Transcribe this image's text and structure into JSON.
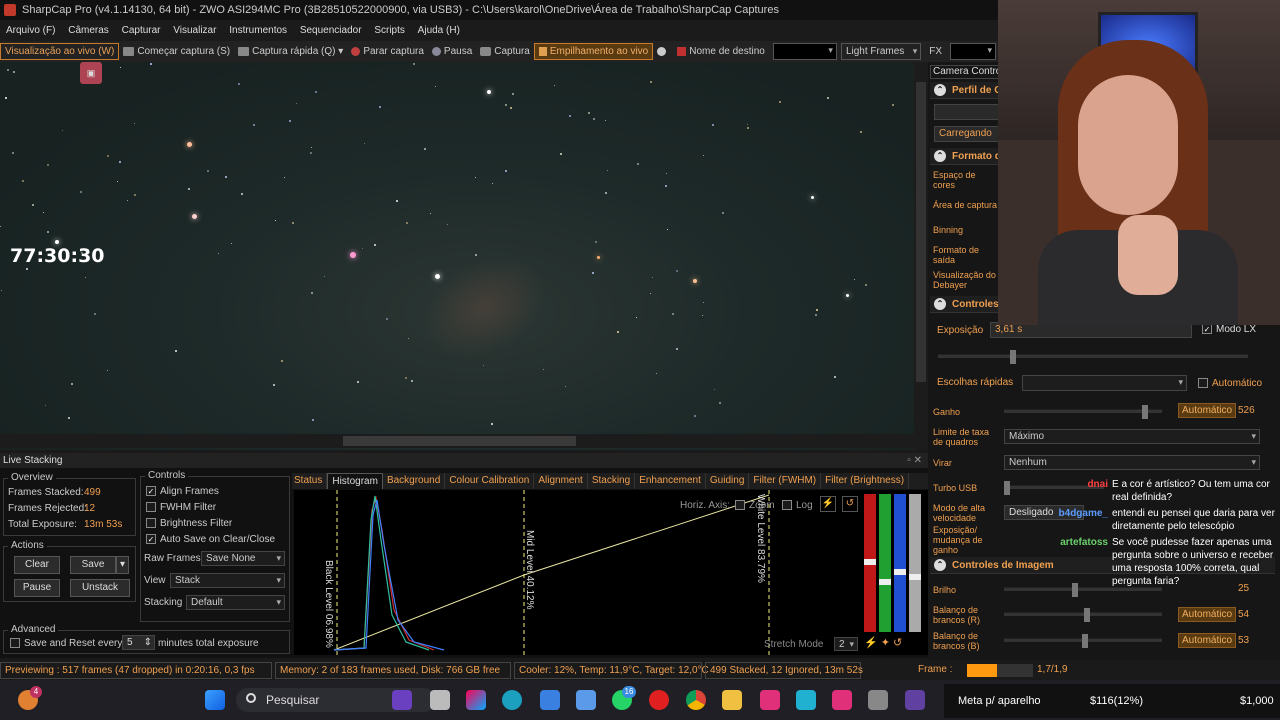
{
  "window": {
    "title": "SharpCap Pro (v4.1.14130, 64 bit) - ZWO ASI294MC Pro (3B28510522000900, via USB3) - C:\\Users\\karol\\OneDrive\\Área de Trabalho\\SharpCap Captures"
  },
  "menu": [
    "Arquivo (F)",
    "Câmeras",
    "Capturar",
    "Visualizar",
    "Instrumentos",
    "Sequenciador",
    "Scripts",
    "Ajuda (H)"
  ],
  "toolbar": {
    "live_view": "Visualização ao vivo (W)",
    "start_capture": "Começar captura (S)",
    "quick_capture": "Captura rápida (Q)",
    "stop_capture": "Parar captura",
    "pause": "Pausa",
    "capture": "Captura",
    "live_stacking": "Empilhamento ao vivo",
    "target_name": "Nome de destino",
    "frame_type": "Light Frames",
    "fx": "FX"
  },
  "preview": {
    "timer": "77:30:30"
  },
  "live_stacking": {
    "title": "Live Stacking",
    "overview": {
      "title": "Overview",
      "frames_stacked_label": "Frames Stacked:",
      "frames_stacked": "499",
      "frames_rejected_label": "Frames Rejected:",
      "frames_rejected": "12",
      "total_exposure_label": "Total Exposure:",
      "total_exposure": "13m 53s"
    },
    "actions": {
      "title": "Actions",
      "clear": "Clear",
      "save": "Save",
      "pause": "Pause",
      "unstack": "Unstack"
    },
    "controls": {
      "title": "Controls",
      "align_frames": "Align Frames",
      "fwhm_filter": "FWHM Filter",
      "brightness_filter": "Brightness Filter",
      "auto_save": "Auto Save on Clear/Close",
      "raw_frames_label": "Raw Frames",
      "raw_frames_value": "Save None",
      "view_label": "View",
      "view_value": "Stack",
      "stacking_label": "Stacking",
      "stacking_value": "Default"
    },
    "advanced": {
      "title": "Advanced",
      "save_reset_label": "Save and Reset every",
      "minutes_value": "5",
      "minutes_suffix": "minutes total exposure"
    },
    "tabs": [
      "Status",
      "Histogram",
      "Background",
      "Colour Calibration",
      "Alignment",
      "Stacking",
      "Enhancement",
      "Guiding",
      "Filter (FWHM)",
      "Filter (Brightness)"
    ],
    "active_tab": "Histogram",
    "histogram": {
      "horiz_axis": "Horiz. Axis:",
      "zoom": "Zoom",
      "log": "Log",
      "black_level": "Black Level  06.98%",
      "mid_level": "Mid Level  40.12%",
      "white_level": "White Level  83.79%",
      "stretch_mode": "Stretch Mode",
      "stretch_value": "2"
    }
  },
  "status_bar": {
    "previewing": "Previewing : 517 frames (47 dropped) in 0:20:16, 0,3 fps",
    "memory": "Memory: 2 of 183 frames used, Disk: 766 GB free",
    "cooler": "Cooler: 12%, Temp: 11,9°C, Target: 12,0°C",
    "stacked": "499 Stacked, 12 Ignored, 13m 52s",
    "frame_label": "Frame :",
    "frame_value": "1,7/1,9"
  },
  "camera_controls": {
    "title": "Camera Controls",
    "profile_section": "Perfil de Controle",
    "loading": "Carregando",
    "format_section": "Formato de Captura",
    "color_space": "Espaço de cores",
    "capture_area": "Área de captura",
    "binning": "Binning",
    "output_format": "Formato de saída",
    "debayer_preview": "Visualização do Debayer",
    "controls_section": "Controles de Câmera",
    "exposure_label": "Exposição",
    "exposure_value": "3,61 s",
    "lx_mode": "Modo LX",
    "quick_picks": "Escolhas rápidas",
    "automatic": "Automático",
    "gain_label": "Ganho",
    "gain_auto": "Automático",
    "gain_value": "526",
    "frame_limit_label": "Limite de taxa de quadros",
    "frame_limit_value": "Máximo",
    "flip_label": "Virar",
    "flip_value": "Nenhum",
    "turbo_usb": "Turbo USB",
    "hs_mode_label": "Modo de alta velocidade",
    "hs_mode_value": "Desligado",
    "exposure_change": "Exposição/ mudança de ganho",
    "image_section": "Controles de Imagem",
    "brightness_label": "Brilho",
    "brightness_value": "25",
    "wb_r_label": "Balanço de brancos (R)",
    "wb_r_auto": "Automático",
    "wb_r_value": "54",
    "wb_b_label": "Balanço de brancos (B)",
    "wb_b_auto": "Automático",
    "wb_b_value": "53"
  },
  "chat": [
    {
      "user": "dnai",
      "color": "#ff4040",
      "text": "E a cor é artístico? Ou tem uma cor real definida?"
    },
    {
      "user": "b4dgame_",
      "color": "#5a9cff",
      "text": "entendi eu pensei que daria para ver diretamente pelo telescópio"
    },
    {
      "user": "artefatoss",
      "color": "#6bd16b",
      "text": "Se você pudesse fazer apenas uma pergunta sobre o universo e receber uma resposta 100% correta, qual pergunta faria?"
    }
  ],
  "taskbar": {
    "search": "Pesquisar",
    "notification": "4",
    "badge": "16",
    "ticker1": "Meta p/ aparelho",
    "ticker2": "$116(12%)",
    "ticker3": "$1,000"
  }
}
